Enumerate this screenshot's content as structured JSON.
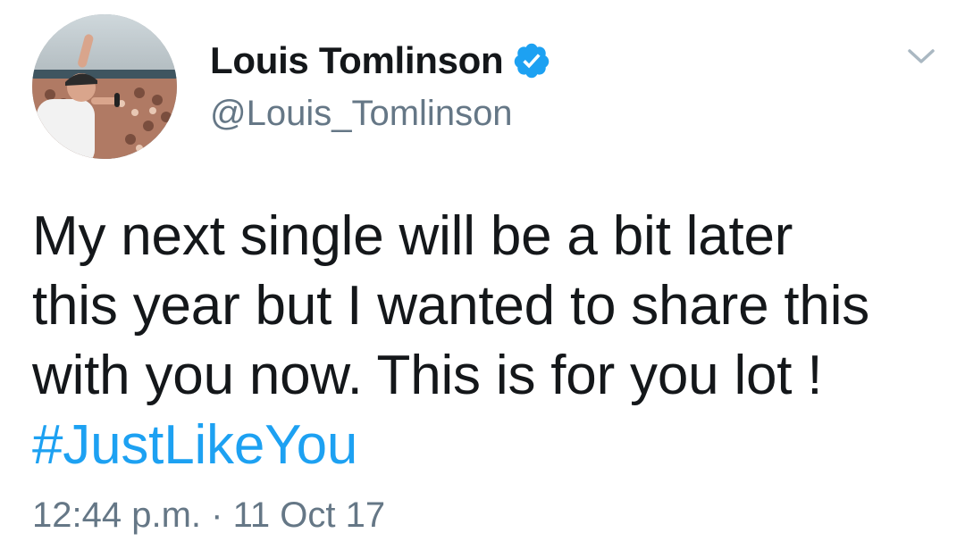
{
  "tweet": {
    "author": {
      "display_name": "Louis Tomlinson",
      "handle": "@Louis_Tomlinson",
      "verified": true
    },
    "text_lines": [
      "My next single will be a bit later",
      "this year but I wanted to share this",
      "with you now. This is for you lot !"
    ],
    "hashtag": "#JustLikeYou",
    "time": "12:44 p.m.",
    "separator": "·",
    "date": "11 Oct 17"
  },
  "icons": {
    "verified": "verified-badge-icon",
    "menu": "chevron-down-icon"
  },
  "colors": {
    "text": "#14171a",
    "secondary": "#657786",
    "accent": "#1da1f2",
    "caret": "#aab8c2"
  }
}
